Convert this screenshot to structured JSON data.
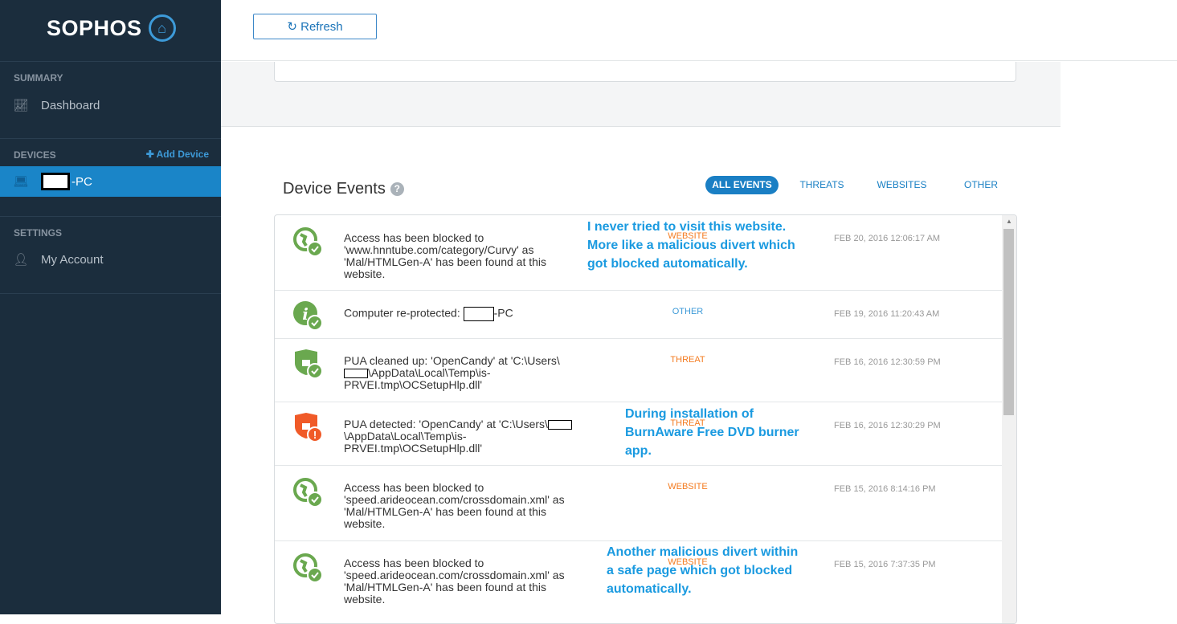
{
  "sidebar": {
    "logo": "SOPHOS",
    "summary": "SUMMARY",
    "dashboard": "Dashboard",
    "devices": "DEVICES",
    "add_device": "Add Device",
    "device": "-PC",
    "settings": "SETTINGS",
    "my_account": "My Account"
  },
  "toolbar": {
    "refresh": "Refresh"
  },
  "events": {
    "title": "Device Events",
    "filters": [
      "ALL EVENTS",
      "THREATS",
      "WEBSITES",
      "OTHER"
    ],
    "rows": [
      {
        "icon": "globe-check-icon",
        "text": "Access has been blocked to 'www.hnntube.com/category/Curvy' as 'Mal/HTMLGen-A' has been found at this website.",
        "type": "WEBSITE",
        "date": "FEB 20, 2016 12:06:17 AM"
      },
      {
        "icon": "info-check-icon",
        "text_pre": "Computer re-protected: ",
        "text_post": "-PC",
        "type": "OTHER",
        "date": "FEB 19, 2016 11:20:43 AM"
      },
      {
        "icon": "shield-check-icon",
        "text_pre": "PUA cleaned up: 'OpenCandy' at 'C:\\Users\\",
        "text_post": "\\AppData\\Local\\Temp\\is-PRVEI.tmp\\OCSetupHlp.dll'",
        "type": "THREAT",
        "date": "FEB 16, 2016 12:30:59 PM"
      },
      {
        "icon": "shield-alert-icon",
        "text_pre": "PUA detected: 'OpenCandy' at 'C:\\Users\\",
        "text_post": "\\AppData\\Local\\Temp\\is-PRVEI.tmp\\OCSetupHlp.dll'",
        "type": "THREAT",
        "date": "FEB 16, 2016 12:30:29 PM"
      },
      {
        "icon": "globe-check-icon",
        "text": "Access has been blocked to 'speed.arideocean.com/crossdomain.xml' as 'Mal/HTMLGen-A' has been found at this website.",
        "type": "WEBSITE",
        "date": "FEB 15, 2016 8:14:16 PM"
      },
      {
        "icon": "globe-check-icon",
        "text": "Access has been blocked to 'speed.arideocean.com/crossdomain.xml' as 'Mal/HTMLGen-A' has been found at this website.",
        "type": "WEBSITE",
        "date": "FEB 15, 2016 7:37:35 PM"
      }
    ]
  },
  "annotations": [
    "I never tried to visit this website. More like a malicious divert which got blocked automatically.",
    "During installation of BurnAware Free DVD burner app.",
    "Another malicious divert within a safe page which got blocked automatically."
  ],
  "colors": {
    "sidebar": "#1b2d3d",
    "accent": "#1a85c8",
    "website": "#f47b20",
    "other": "#3d9ad8",
    "threat": "#f47b20",
    "ok": "#6aa84f",
    "alert": "#f05a28"
  }
}
